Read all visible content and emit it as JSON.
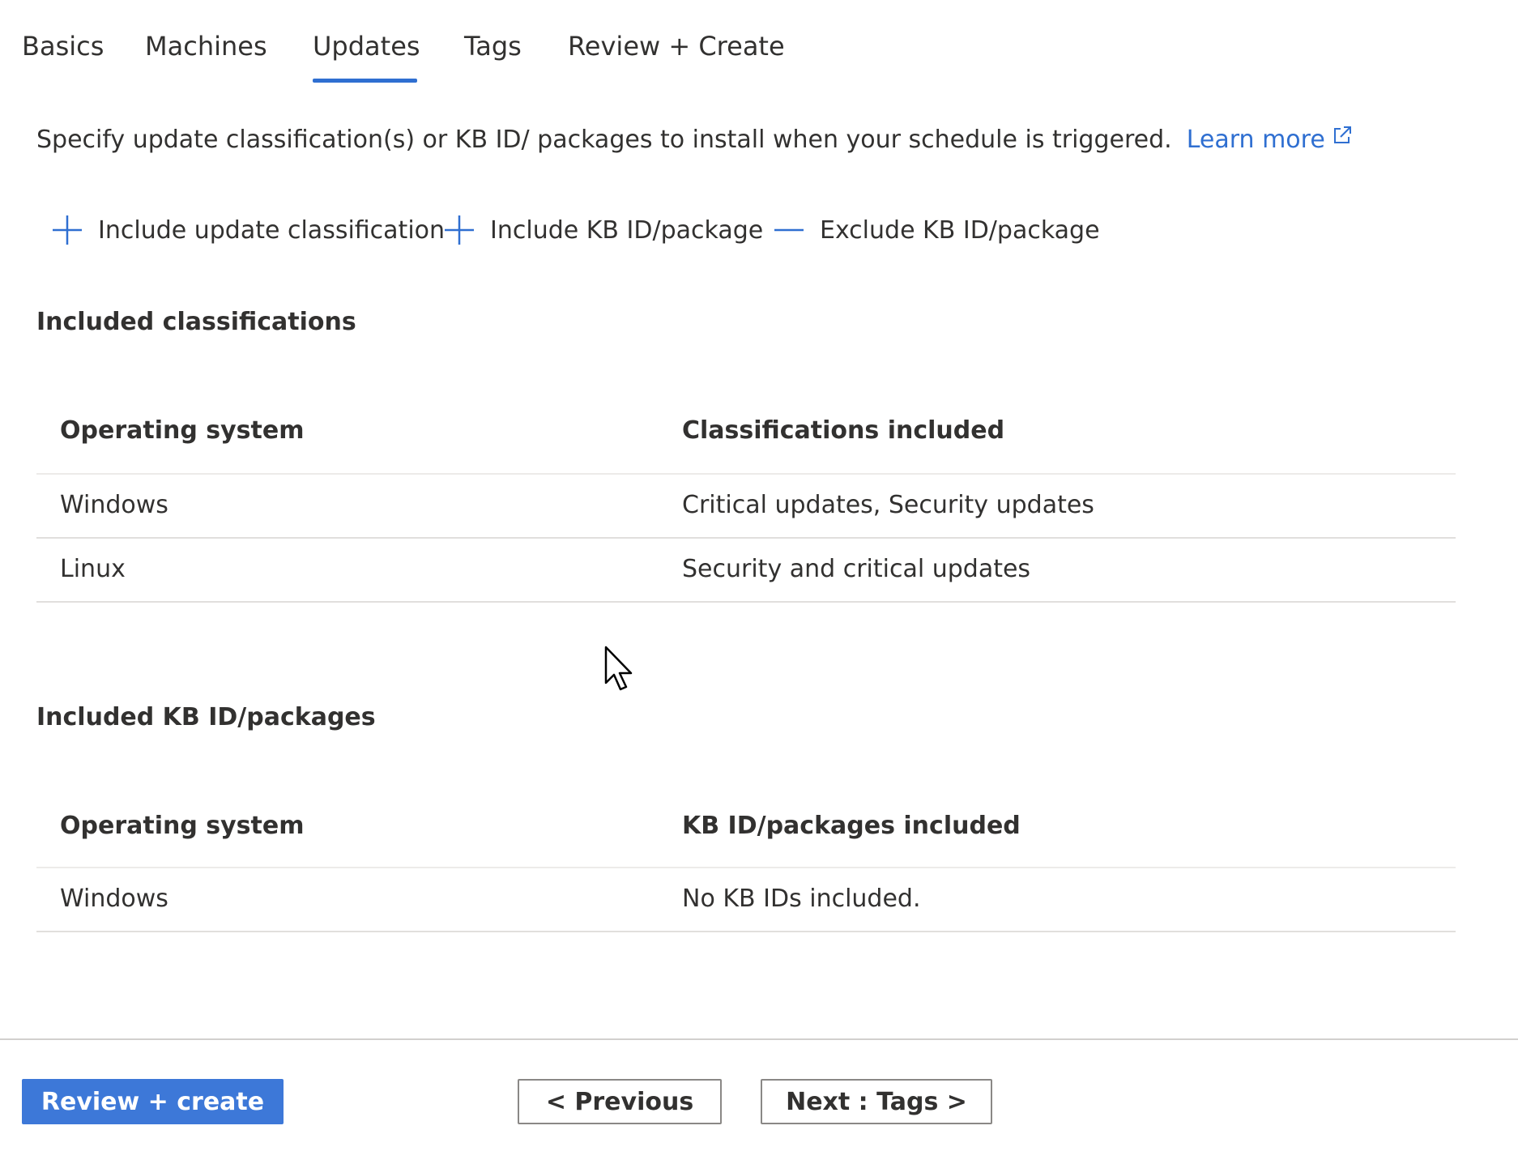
{
  "tabs": [
    {
      "label": "Basics",
      "active": false
    },
    {
      "label": "Machines",
      "active": false
    },
    {
      "label": "Updates",
      "active": true
    },
    {
      "label": "Tags",
      "active": false
    },
    {
      "label": "Review + Create",
      "active": false
    }
  ],
  "description": {
    "text": "Specify update classification(s) or KB ID/ packages to install when your schedule is triggered.",
    "link_label": "Learn more",
    "link_icon": "external-link-icon"
  },
  "commands": {
    "include_classification": {
      "label": "Include update classification",
      "icon": "plus-icon"
    },
    "include_kb": {
      "label": "Include KB ID/package",
      "icon": "plus-icon"
    },
    "exclude_kb": {
      "label": "Exclude KB ID/package",
      "icon": "minus-icon"
    }
  },
  "classifications": {
    "title": "Included classifications",
    "columns": [
      "Operating system",
      "Classifications included"
    ],
    "rows": [
      [
        "Windows",
        "Critical updates, Security updates"
      ],
      [
        "Linux",
        "Security and critical updates"
      ]
    ]
  },
  "kb_packages": {
    "title": "Included KB ID/packages",
    "columns": [
      "Operating system",
      "KB ID/packages included"
    ],
    "rows": [
      [
        "Windows",
        "No KB IDs included."
      ]
    ]
  },
  "footer": {
    "review_create": "Review + create",
    "previous": "< Previous",
    "next": "Next : Tags >"
  },
  "colors": {
    "accent": "#2f6fd1",
    "primary_button": "#3d78d8",
    "text": "#323130",
    "divider": "#e1dfdd"
  }
}
